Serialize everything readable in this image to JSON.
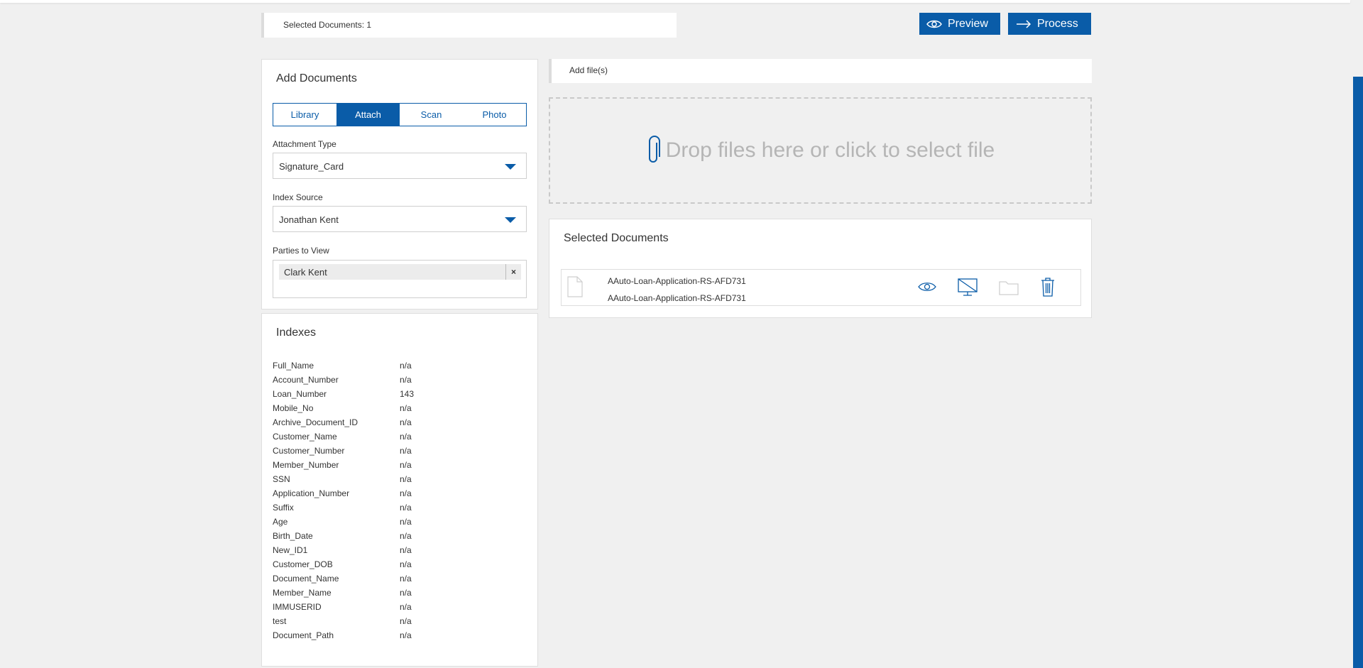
{
  "header": {
    "selected_count": "Selected Documents: 1",
    "preview_label": "Preview",
    "process_label": "Process"
  },
  "add_documents": {
    "title": "Add Documents",
    "tabs": [
      {
        "label": "Library",
        "active": false
      },
      {
        "label": "Attach",
        "active": true
      },
      {
        "label": "Scan",
        "active": false
      },
      {
        "label": "Photo",
        "active": false
      }
    ],
    "attachment_type_label": "Attachment Type",
    "attachment_type_value": "Signature_Card",
    "index_source_label": "Index Source",
    "index_source_value": "Jonathan Kent",
    "parties_label": "Parties to View",
    "parties": [
      "Clark Kent"
    ],
    "chip_remove": "×"
  },
  "indexes": {
    "title": "Indexes",
    "rows": [
      {
        "name": "Full_Name",
        "value": "n/a"
      },
      {
        "name": "Account_Number",
        "value": "n/a"
      },
      {
        "name": "Loan_Number",
        "value": "143"
      },
      {
        "name": "Mobile_No",
        "value": "n/a"
      },
      {
        "name": "Archive_Document_ID",
        "value": "n/a"
      },
      {
        "name": "Customer_Name",
        "value": "n/a"
      },
      {
        "name": "Customer_Number",
        "value": "n/a"
      },
      {
        "name": "Member_Number",
        "value": "n/a"
      },
      {
        "name": "SSN",
        "value": "n/a"
      },
      {
        "name": "Application_Number",
        "value": "n/a"
      },
      {
        "name": "Suffix",
        "value": "n/a"
      },
      {
        "name": "Age",
        "value": "n/a"
      },
      {
        "name": "Birth_Date",
        "value": "n/a"
      },
      {
        "name": "New_ID1",
        "value": "n/a"
      },
      {
        "name": "Customer_DOB",
        "value": "n/a"
      },
      {
        "name": "Document_Name",
        "value": "n/a"
      },
      {
        "name": "Member_Name",
        "value": "n/a"
      },
      {
        "name": "IMMUSERID",
        "value": "n/a"
      },
      {
        "name": "test",
        "value": "n/a"
      },
      {
        "name": "Document_Path",
        "value": "n/a"
      }
    ]
  },
  "upload": {
    "add_files_label": "Add file(s)",
    "drop_text": "Drop files here or click to select file"
  },
  "selected_documents": {
    "title": "Selected Documents",
    "items": [
      {
        "name": "AAuto-Loan-Application-RS-AFD731",
        "subname": "AAuto-Loan-Application-RS-AFD731"
      }
    ]
  },
  "colors": {
    "accent": "#0a5ca8",
    "background": "#f0f0f0"
  }
}
